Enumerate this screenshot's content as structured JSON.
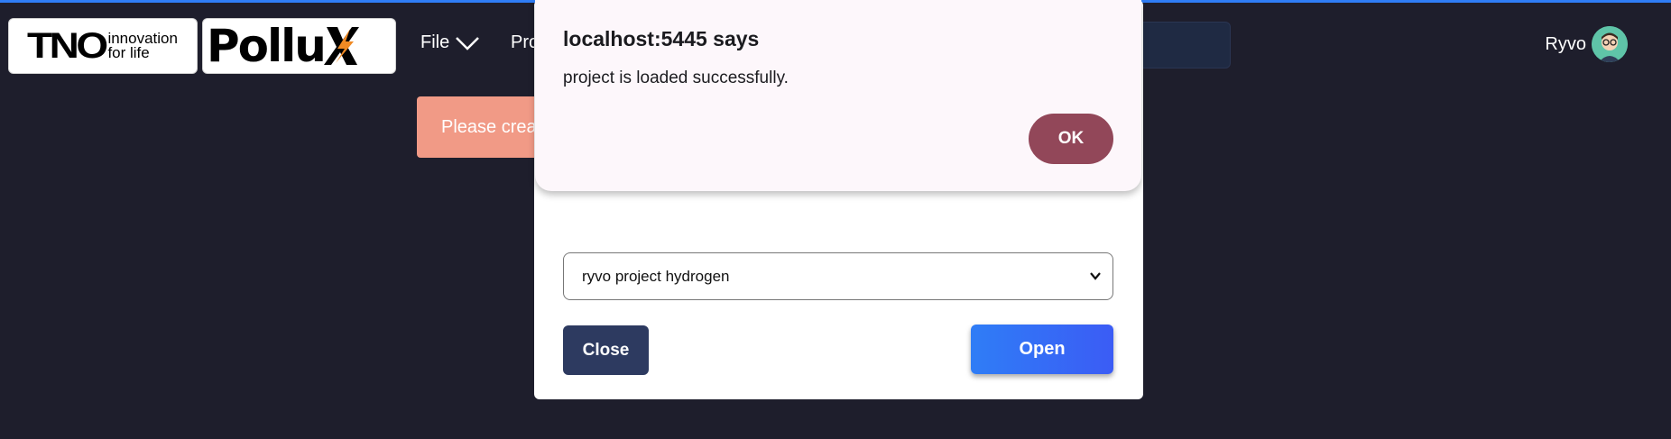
{
  "header": {
    "tno_logo_mark": "TNO",
    "tno_tagline_line1": "innovation",
    "tno_tagline_line2": "for life",
    "pollux_logo_text": "Pollu",
    "menu": [
      {
        "label": "File"
      },
      {
        "label": "Pro"
      }
    ],
    "user_name": "Ryvo"
  },
  "banner": {
    "text": "Please creat"
  },
  "open_project_modal": {
    "selected_project": "ryvo project hydrogen",
    "close_label": "Close",
    "open_label": "Open"
  },
  "browser_dialog": {
    "title": "localhost:5445 says",
    "message": "project is loaded successfully.",
    "ok_label": "OK"
  },
  "colors": {
    "background": "#1e1e2c",
    "accent_blue": "#2f7df6",
    "ok_button": "#924759",
    "banner": "#f19a86",
    "close_button": "#2d3a60"
  }
}
